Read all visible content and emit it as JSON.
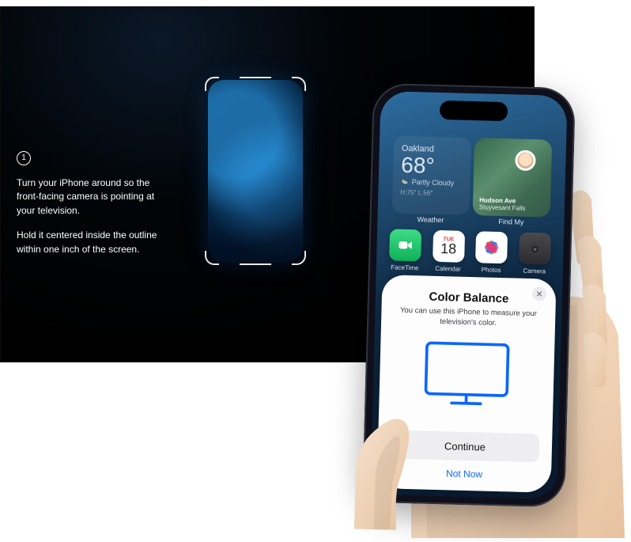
{
  "tv_instructions": {
    "step_label": "1",
    "paragraph1": "Turn your iPhone around so the front-facing camera is pointing at your television.",
    "paragraph2": "Hold it centered inside the outline within one inch of the screen."
  },
  "phone": {
    "weather": {
      "city": "Oakland",
      "temp": "68°",
      "condition": "Partly Cloudy",
      "hi_lo": "H:75° L:56°",
      "widget_label": "Weather"
    },
    "find_my": {
      "place": "Hudson Ave",
      "subplace": "Stuyvesant Falls",
      "widget_label": "Find My"
    },
    "apps": {
      "facetime": "FaceTime",
      "calendar": "Calendar",
      "calendar_dow": "TUE",
      "calendar_num": "18",
      "photos": "Photos",
      "camera": "Camera"
    },
    "sheet": {
      "title": "Color Balance",
      "subtitle": "You can use this iPhone to measure your television's color.",
      "continue_label": "Continue",
      "not_now_label": "Not Now",
      "close_glyph": "✕"
    }
  },
  "colors": {
    "accent_blue": "#0a66ff"
  }
}
